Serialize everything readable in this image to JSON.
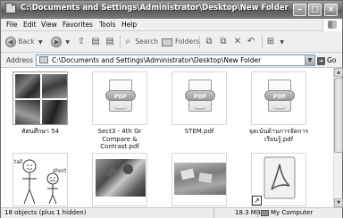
{
  "window": {
    "title": "C:\\Documents and Settings\\Administrator\\Desktop\\New Folder"
  },
  "menu": [
    "File",
    "Edit",
    "View",
    "Favorites",
    "Tools",
    "Help"
  ],
  "toolbar": {
    "back_label": "Back",
    "search_label": "Search",
    "folders_label": "Folders"
  },
  "address": {
    "label": "Address",
    "path": "C:\\Documents and Settings\\Administrator\\Desktop\\New Folder",
    "go_label": "Go"
  },
  "files": [
    {
      "name": "ทัศนศึกษา 54",
      "kind": "photos"
    },
    {
      "name": "Sect3 - 4th Gr Compare & Contrast.pdf",
      "kind": "pdf"
    },
    {
      "name": "STEM.pdf",
      "kind": "pdf"
    },
    {
      "name": "จุดเน้นด้านการจัดการเรียนรู้.pdf",
      "kind": "pdf"
    },
    {
      "name": "",
      "kind": "drawing",
      "text": {
        "tall": "tall",
        "short": "short"
      }
    },
    {
      "name": "",
      "kind": "photo"
    },
    {
      "name": "",
      "kind": "photo"
    },
    {
      "name": "",
      "kind": "acrobat-shortcut"
    }
  ],
  "pdf_badge": "PDF",
  "status": {
    "objects": "18 objects (plus 1 hidden)",
    "size": "18.3 MB",
    "location": "My Computer"
  }
}
